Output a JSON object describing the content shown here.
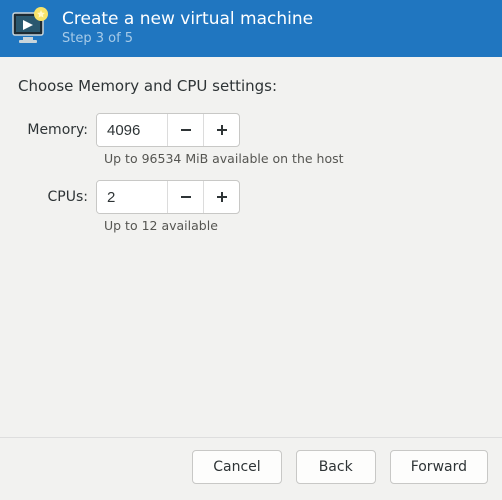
{
  "header": {
    "title": "Create a new virtual machine",
    "step": "Step 3 of 5"
  },
  "main": {
    "heading": "Choose Memory and CPU settings:",
    "memory": {
      "label": "Memory:",
      "value": "4096",
      "hint": "Up to 96534 MiB available on the host"
    },
    "cpus": {
      "label": "CPUs:",
      "value": "2",
      "hint": "Up to 12 available"
    }
  },
  "footer": {
    "cancel": "Cancel",
    "back": "Back",
    "forward": "Forward"
  }
}
